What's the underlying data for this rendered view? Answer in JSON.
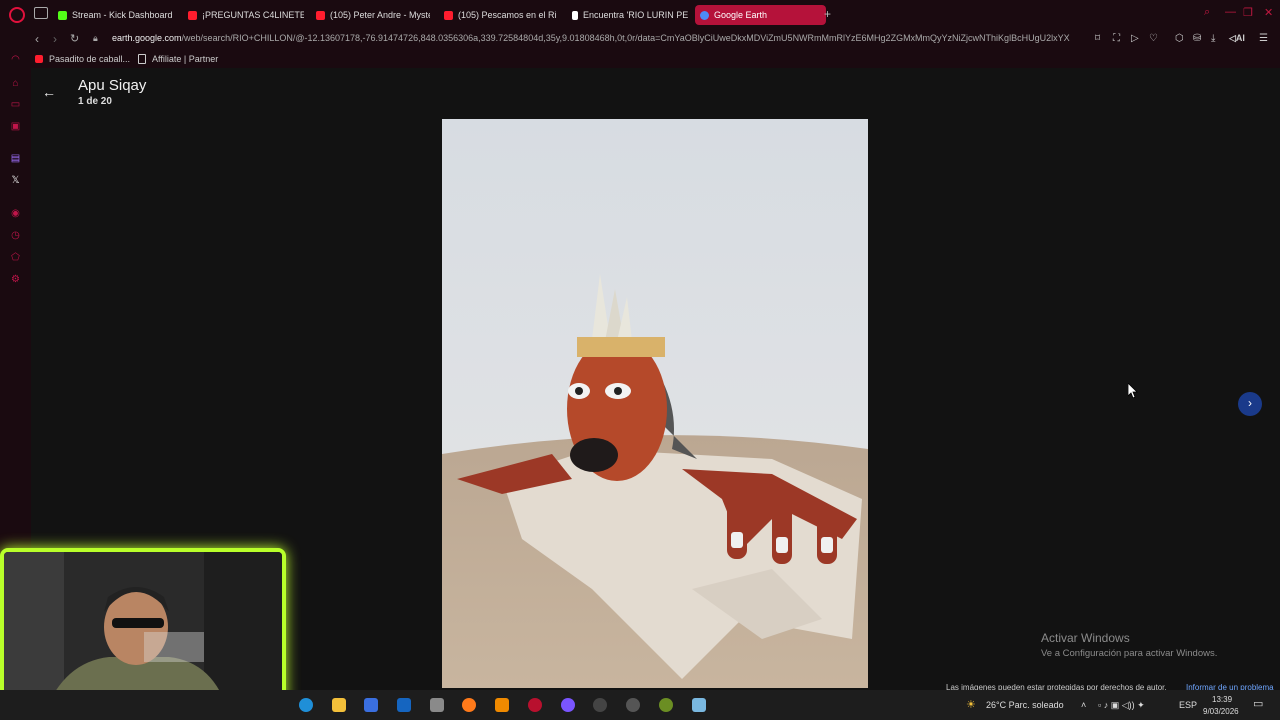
{
  "tabs": [
    {
      "label": "Stream - Kick Dashboard",
      "icon": "kick-icon",
      "color": "#53fc18"
    },
    {
      "label": "¡PREGUNTAS C4LINETES -",
      "icon": "youtube-icon",
      "color": "#ff1d2e"
    },
    {
      "label": "(105) Peter Andre - Myste",
      "icon": "youtube-icon",
      "color": "#ff1d2e"
    },
    {
      "label": "(105) Pescamos en el Rio",
      "icon": "youtube-icon",
      "color": "#ff1d2e"
    },
    {
      "label": "Encuentra 'RIO LURIN PEC",
      "icon": "tiktok-icon",
      "color": "#ffffff"
    },
    {
      "label": "Google Earth",
      "icon": "google-earth-icon",
      "color": "#4c8bf5"
    }
  ],
  "address": {
    "domain": "earth.google.com",
    "path": "/web/search/RIO+CHILLON/@-12.13607178,-76.91474726,848.0356306a,339.72584804d,35y,9.01808468h,0t,0r/data=CmYaOBlyCiUweDkxMDViZmU5NWRmMmRlYzE6MHg2ZGMxMmQyYzNiZjcwNThiKglBcHUgU2lxYX"
  },
  "bookmarks": [
    {
      "label": "Pasadito de caball...",
      "icon": "youtube-icon"
    },
    {
      "label": "Affiliate | Partner",
      "icon": "page-icon"
    }
  ],
  "viewer": {
    "title": "Apu Siqay",
    "counter": "1 de 20"
  },
  "notices": {
    "activate_title": "Activar Windows",
    "activate_sub": "Ve a Configuración para activar Windows.",
    "copyright": "Las imágenes pueden estar protegidas por derechos de autor.",
    "report": "Informar de un problema"
  },
  "taskbar": {
    "weather": "26°C  Parc. soleado",
    "lang": "ESP",
    "time": "13:39",
    "date": "9/03/2026"
  }
}
